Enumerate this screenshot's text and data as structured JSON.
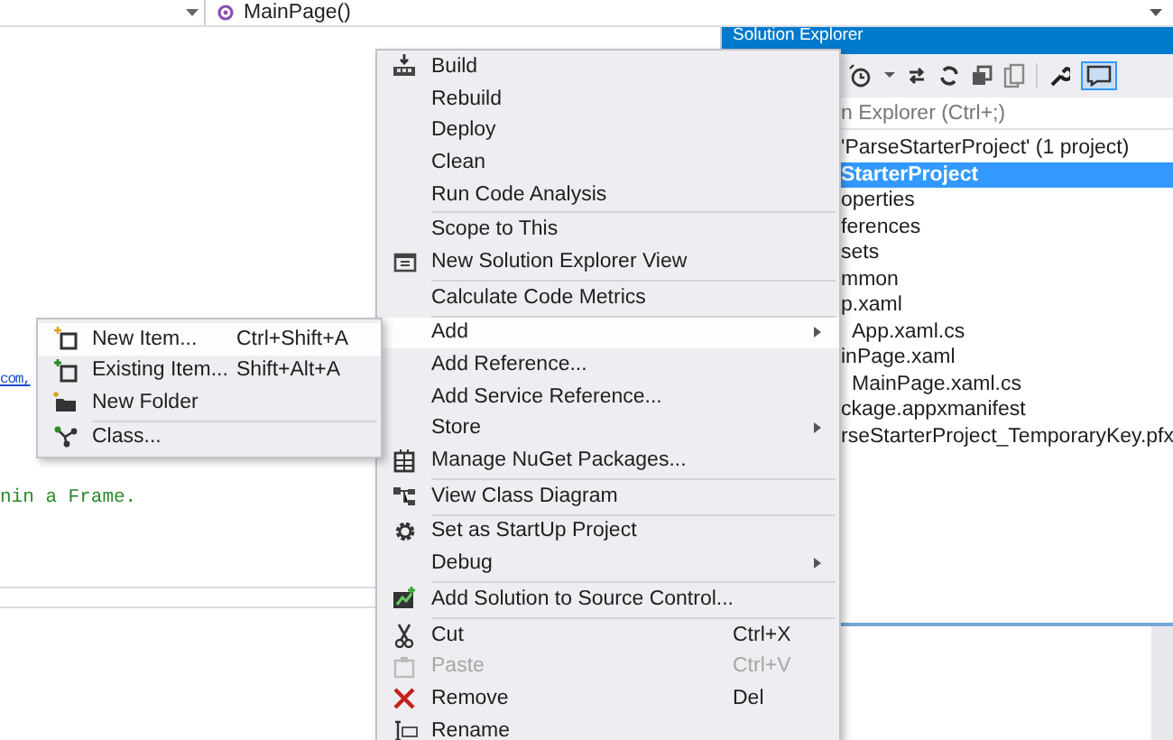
{
  "editor": {
    "member_dropdown": "MainPage()",
    "code_lines": [
      {
        "kind": "link",
        "text": "com,"
      },
      {
        "kind": "comment",
        "text": "nin a Frame."
      }
    ]
  },
  "solution_explorer": {
    "title": "Solution Explorer",
    "search": {
      "placeholder": "n Explorer (Ctrl+;)"
    },
    "tree": [
      {
        "label": "'ParseStarterProject' (1 project)",
        "selected": false,
        "children": [
          {
            "label": "StarterProject",
            "selected": true,
            "children": [
              {
                "label": "operties",
                "selected": false
              },
              {
                "label": "ferences",
                "selected": false
              },
              {
                "label": "sets",
                "selected": false
              },
              {
                "label": "mmon",
                "selected": false
              },
              {
                "label": "p.xaml",
                "selected": false,
                "children": [
                  {
                    "label": "App.xaml.cs",
                    "selected": false
                  }
                ]
              },
              {
                "label": "inPage.xaml",
                "selected": false,
                "children": [
                  {
                    "label": "MainPage.xaml.cs",
                    "selected": false
                  }
                ]
              },
              {
                "label": "ckage.appxmanifest",
                "selected": false
              },
              {
                "label": "rseStarterProject_TemporaryKey.pfx",
                "selected": false
              }
            ]
          }
        ]
      }
    ]
  },
  "context_menu": [
    {
      "label": "Build",
      "selected": false,
      "disabled": false,
      "submenu": false,
      "separator_after": false
    },
    {
      "label": "Rebuild",
      "selected": false,
      "disabled": false,
      "submenu": false,
      "separator_after": false
    },
    {
      "label": "Deploy",
      "selected": false,
      "disabled": false,
      "submenu": false,
      "separator_after": false
    },
    {
      "label": "Clean",
      "selected": false,
      "disabled": false,
      "submenu": false,
      "separator_after": false
    },
    {
      "label": "Run Code Analysis",
      "selected": false,
      "disabled": false,
      "submenu": false,
      "separator_after": true
    },
    {
      "label": "Scope to This",
      "selected": false,
      "disabled": false,
      "submenu": false,
      "separator_after": false
    },
    {
      "label": "New Solution Explorer View",
      "selected": false,
      "disabled": false,
      "submenu": false,
      "separator_after": true
    },
    {
      "label": "Calculate Code Metrics",
      "selected": false,
      "disabled": false,
      "submenu": false,
      "separator_after": true
    },
    {
      "label": "Add",
      "selected": true,
      "disabled": false,
      "submenu": true,
      "separator_after": false
    },
    {
      "label": "Add Reference...",
      "selected": false,
      "disabled": false,
      "submenu": false,
      "separator_after": false
    },
    {
      "label": "Add Service Reference...",
      "selected": false,
      "disabled": false,
      "submenu": false,
      "separator_after": false
    },
    {
      "label": "Store",
      "selected": false,
      "disabled": false,
      "submenu": true,
      "separator_after": false
    },
    {
      "label": "Manage NuGet Packages...",
      "selected": false,
      "disabled": false,
      "submenu": false,
      "separator_after": true
    },
    {
      "label": "View Class Diagram",
      "selected": false,
      "disabled": false,
      "submenu": false,
      "separator_after": true
    },
    {
      "label": "Set as StartUp Project",
      "selected": false,
      "disabled": false,
      "submenu": false,
      "separator_after": false
    },
    {
      "label": "Debug",
      "selected": false,
      "disabled": false,
      "submenu": true,
      "separator_after": true
    },
    {
      "label": "Add Solution to Source Control...",
      "selected": false,
      "disabled": false,
      "submenu": false,
      "separator_after": true
    },
    {
      "label": "Cut",
      "shortcut": "Ctrl+X",
      "selected": false,
      "disabled": false,
      "submenu": false,
      "separator_after": false
    },
    {
      "label": "Paste",
      "shortcut": "Ctrl+V",
      "selected": false,
      "disabled": true,
      "submenu": false,
      "separator_after": false
    },
    {
      "label": "Remove",
      "shortcut": "Del",
      "selected": false,
      "disabled": false,
      "submenu": false,
      "separator_after": false
    },
    {
      "label": "Rename",
      "selected": false,
      "disabled": false,
      "submenu": false,
      "separator_after": false
    }
  ],
  "add_submenu": [
    {
      "label": "New Item...",
      "shortcut": "Ctrl+Shift+A",
      "selected": true,
      "separator_after": false
    },
    {
      "label": "Existing Item...",
      "shortcut": "Shift+Alt+A",
      "selected": false,
      "separator_after": false
    },
    {
      "label": "New Folder",
      "selected": false,
      "separator_after": true
    },
    {
      "label": "Class...",
      "selected": false,
      "separator_after": false
    }
  ]
}
